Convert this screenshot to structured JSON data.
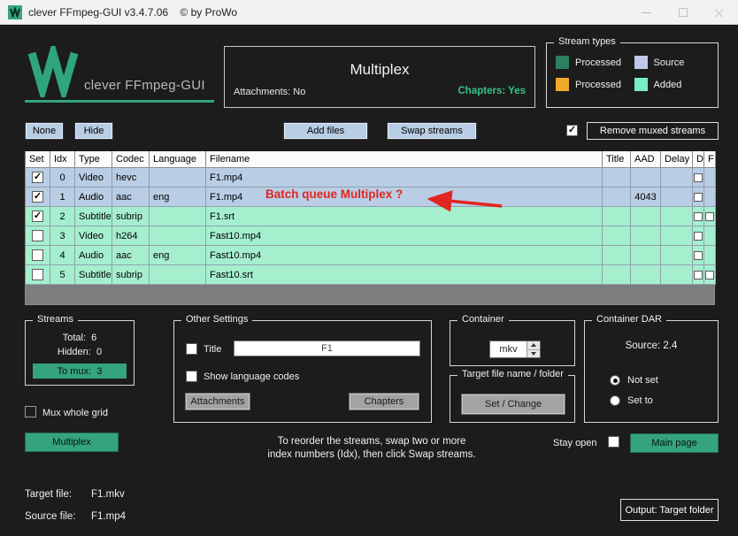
{
  "colors": {
    "accent": "#35a47e",
    "annotation": "#e02620",
    "row_source": "#b9cde5",
    "row_added": "#a5efcf"
  },
  "titlebar": {
    "title": "clever FFmpeg-GUI v3.4.7.06    © by ProWo"
  },
  "header": {
    "logo_text": "clever FFmpeg-GUI",
    "info": {
      "attachments": "Attachments: No",
      "title": "Multiplex",
      "chapters": "Chapters: Yes"
    },
    "stream_types": {
      "label": "Stream types",
      "items": [
        {
          "label": "Processed",
          "color": "#2e7f5e"
        },
        {
          "label": "Source",
          "color": "#bfc8ea"
        },
        {
          "label": "Processed",
          "color": "#efa928"
        },
        {
          "label": "Added",
          "color": "#79eec6"
        }
      ]
    }
  },
  "toolbar": {
    "none": "None",
    "hide": "Hide",
    "add_files": "Add files",
    "swap_streams": "Swap streams",
    "remove_checkbox_checked": true,
    "remove_muxed": "Remove muxed streams"
  },
  "table": {
    "columns": [
      "Set",
      "Idx",
      "Type",
      "Codec",
      "Language",
      "Filename",
      "Title",
      "AAD",
      "Delay",
      "D",
      "F"
    ],
    "row_colors": {
      "source": "#b9cde5",
      "added": "#a5efcf"
    },
    "rows": [
      {
        "set": true,
        "idx": "0",
        "type": "Video",
        "codec": "hevc",
        "language": "",
        "filename": "F1.mp4",
        "title": "",
        "aad": "",
        "delay": "",
        "group": "source",
        "d": false,
        "f": null
      },
      {
        "set": true,
        "idx": "1",
        "type": "Audio",
        "codec": "aac",
        "language": "eng",
        "filename": "F1.mp4",
        "title": "",
        "aad": "4043",
        "delay": "",
        "group": "source",
        "d": false,
        "f": null
      },
      {
        "set": true,
        "idx": "2",
        "type": "Subtitle",
        "codec": "subrip",
        "language": "",
        "filename": "F1.srt",
        "title": "",
        "aad": "",
        "delay": "",
        "group": "added",
        "d": false,
        "f": false
      },
      {
        "set": false,
        "idx": "3",
        "type": "Video",
        "codec": "h264",
        "language": "",
        "filename": "Fast10.mp4",
        "title": "",
        "aad": "",
        "delay": "",
        "group": "added",
        "d": false,
        "f": null
      },
      {
        "set": false,
        "idx": "4",
        "type": "Audio",
        "codec": "aac",
        "language": "eng",
        "filename": "Fast10.mp4",
        "title": "",
        "aad": "",
        "delay": "",
        "group": "added",
        "d": false,
        "f": null
      },
      {
        "set": false,
        "idx": "5",
        "type": "Subtitle",
        "codec": "subrip",
        "language": "",
        "filename": "Fast10.srt",
        "title": "",
        "aad": "",
        "delay": "",
        "group": "added",
        "d": false,
        "f": false
      }
    ]
  },
  "annotation": {
    "text": "Batch queue Multiplex ?"
  },
  "streams_box": {
    "label": "Streams",
    "total": "Total:  6",
    "hidden": "Hidden:  0",
    "to_mux": "To mux:  3"
  },
  "left_controls": {
    "mux_whole_grid": "Mux whole grid",
    "mux_whole_grid_checked": false,
    "multiplex": "Multiplex"
  },
  "other_settings": {
    "label": "Other Settings",
    "title_checkbox": "Title",
    "title_checked": false,
    "title_value": "F1",
    "show_language_codes": "Show language codes",
    "show_language_checked": false,
    "attachments": "Attachments",
    "chapters": "Chapters"
  },
  "container_box": {
    "label": "Container",
    "value": "mkv"
  },
  "target_box": {
    "label": "Target file name / folder",
    "button": "Set / Change"
  },
  "dar_box": {
    "label": "Container DAR",
    "source": "Source: 2.4",
    "options": [
      {
        "label": "Not set",
        "selected": true
      },
      {
        "label": "Set to",
        "selected": false
      }
    ]
  },
  "hint": {
    "line1": "To reorder the streams, swap two or more",
    "line2": "index numbers (Idx), then click Swap streams."
  },
  "right_controls": {
    "stay_open": "Stay open",
    "stay_open_checked": false,
    "main_page": "Main page"
  },
  "footer": {
    "target_label": "Target file:",
    "target_value": "F1.mkv",
    "source_label": "Source file:",
    "source_value": "F1.mp4",
    "output_button": "Output: Target folder"
  }
}
